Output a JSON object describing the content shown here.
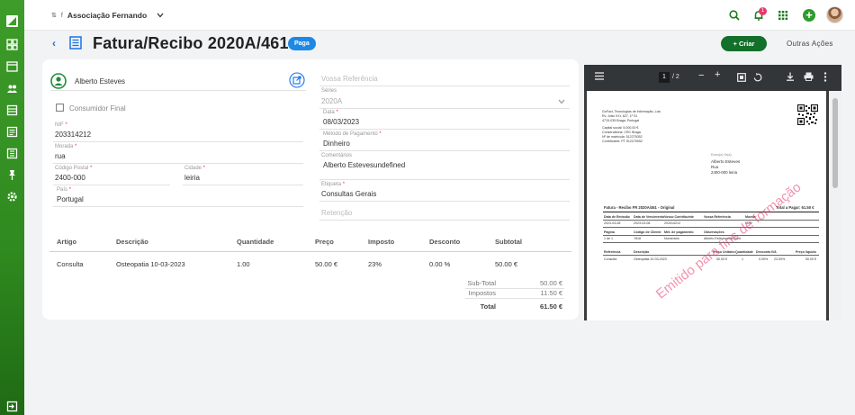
{
  "header": {
    "org_prefix": "f",
    "org_name": "Associação Fernando",
    "notifications": "1"
  },
  "title": {
    "text": "Fatura/Recibo 2020A/461",
    "status": "Paga",
    "create_label": "+ Criar",
    "more_actions": "Outras Ações"
  },
  "client": {
    "name": "Alberto Esteves",
    "consumer_label": "Consumidor Final",
    "nif_label": "NIF",
    "nif": "203314212",
    "address_label": "Morada",
    "address": "rua",
    "postal_label": "Código Postal",
    "postal": "2400-000",
    "city_label": "Cidade",
    "city": "leiria",
    "country_label": "País",
    "country": "Portugal"
  },
  "doc": {
    "reference_placeholder": "Vossa Referência",
    "series_label": "Séries",
    "series": "2020A",
    "date_label": "Data",
    "date": "08/03/2023",
    "payment_label": "Método de Pagamento",
    "payment": "Dinheiro",
    "comments_label": "Comentários",
    "comments": "Alberto Estevesundefined",
    "tag_label": "Etiqueta",
    "tag": "Consultas Gerais",
    "retention_placeholder": "Retenção"
  },
  "table": {
    "headers": [
      "Artigo",
      "Descrição",
      "Quantidade",
      "Preço",
      "Imposto",
      "Desconto",
      "Subtotal"
    ],
    "rows": [
      [
        "Consulta",
        "Osteopatia 10-03-2023",
        "1.00",
        "50.00 €",
        "23%",
        "0.00 %",
        "50.00 €"
      ]
    ]
  },
  "totals": {
    "subtotal_label": "Sub-Total",
    "subtotal": "50.00 €",
    "taxes_label": "Impostos",
    "taxes": "11.50 €",
    "total_label": "Total",
    "total": "61.50 €"
  },
  "pdf": {
    "page_current": "1",
    "page_total": "/ 2",
    "issuer": [
      "GoFact, Tecnologias de Informação, Lda",
      "Rv. João XXI, 627, 1º S1",
      "4715-035 Braga, Portugal"
    ],
    "issuer_meta": [
      "Capital social: 5.000,00 €",
      "Conservatória: CRC Braga",
      "Nº de matrícula: 512275052",
      "Contribuinte: PT 512275052"
    ],
    "client_label": "Exmo(a) Sr(a).",
    "client_name": "Alberto Esteves",
    "client_street": "Rua",
    "client_city": "2400-000 leiria",
    "doc_title": "Fatura - Recibo FR 2020A/461 - Original",
    "total_pay": "Total a Pagar: 61.50 €",
    "meta_headers": [
      "Data de Emissão",
      "Data de Vencimento",
      "Vosso Contribuinte",
      "Vossa Referência",
      "Moeda"
    ],
    "meta_values": [
      "2023-03-08",
      "2023-03-08",
      "203314212",
      "",
      "EUR"
    ],
    "meta2_headers": [
      "Página",
      "Código de Cliente",
      "Mét. de pagamento",
      "Observações"
    ],
    "meta2_values": [
      "1 de 1",
      "7818",
      "Numerário",
      "Alberto Estevesundefined"
    ],
    "line_headers": [
      "Referência",
      "Descrição",
      "Preço Unitário",
      "Quantidade",
      "Desconto",
      "IVA",
      "Preço líquido"
    ],
    "line_values": [
      "Consulta",
      "Osteopatia 10-03-2023",
      "50.00 €",
      "1",
      "0.00%",
      "23.00%",
      "50.00 €"
    ],
    "watermark": "Emitido para fins de formação"
  },
  "colors": {
    "accent": "#1e88e5",
    "brand_green": "#2f8a1f",
    "create_button": "#12702a"
  }
}
